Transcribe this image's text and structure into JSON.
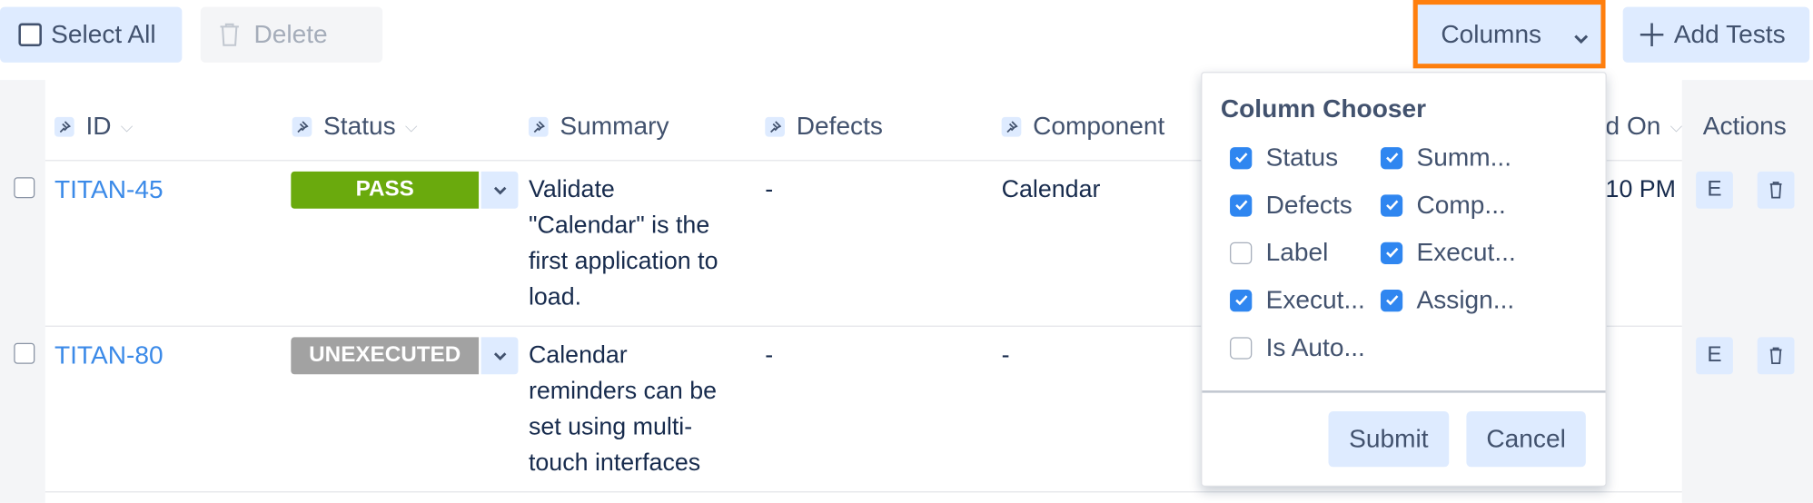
{
  "toolbar": {
    "select_all_label": "Select All",
    "delete_label": "Delete",
    "columns_label": "Columns",
    "add_tests_label": "Add Tests"
  },
  "table": {
    "columns": [
      "ID",
      "Status",
      "Summary",
      "Defects",
      "Component",
      "d On",
      "Actions"
    ],
    "rows": [
      {
        "id": "TITAN-45",
        "status": "PASS",
        "status_color": "#6aaa0d",
        "summary_lines": [
          "Validate",
          "\"Calendar\" is the",
          "first application to",
          "load."
        ],
        "defects": "-",
        "component": "Calendar",
        "executed_on": "10 PM",
        "edit_label": "E"
      },
      {
        "id": "TITAN-80",
        "status": "UNEXECUTED",
        "status_color": "#a2a2a2",
        "summary_lines": [
          "Calendar",
          "reminders can be",
          "set using multi-",
          "touch interfaces"
        ],
        "defects": "-",
        "component": "-",
        "edit_label": "E"
      }
    ]
  },
  "column_chooser": {
    "title": "Column Chooser",
    "items": [
      {
        "label": "Status",
        "checked": true
      },
      {
        "label": "Summ...",
        "checked": true
      },
      {
        "label": "Defects",
        "checked": true
      },
      {
        "label": "Comp...",
        "checked": true
      },
      {
        "label": "Label",
        "checked": false
      },
      {
        "label": "Execut...",
        "checked": true
      },
      {
        "label": "Execut...",
        "checked": true
      },
      {
        "label": "Assign...",
        "checked": true
      },
      {
        "label": "Is Auto...",
        "checked": false
      }
    ],
    "submit_label": "Submit",
    "cancel_label": "Cancel"
  },
  "colors": {
    "accent": "#2f86f0",
    "link": "#3b8ae8",
    "highlight": "#ff7f0e",
    "button_bg": "#deebff"
  }
}
